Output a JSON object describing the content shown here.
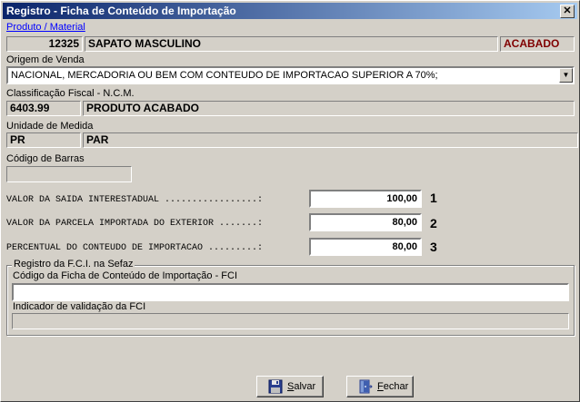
{
  "window": {
    "title": "Registro - Ficha de Conteúdo de Importação",
    "close_glyph": "✕"
  },
  "produto": {
    "label": "Produto / Material",
    "code": "12325",
    "name": "SAPATO MASCULINO",
    "status": "ACABADO",
    "status_color": "#800000"
  },
  "origem": {
    "label": "Origem de Venda",
    "selected": "NACIONAL, MERCADORIA OU BEM COM CONTEUDO DE IMPORTACAO SUPERIOR A 70%;",
    "arrow": "▼"
  },
  "ncm": {
    "label": "Classificação Fiscal - N.C.M.",
    "code": "6403.99",
    "description": "PRODUTO ACABADO"
  },
  "unidade": {
    "label": "Unidade de Medida",
    "code": "PR",
    "description": "PAR"
  },
  "barras": {
    "label": "Código de Barras",
    "value": ""
  },
  "valores": [
    {
      "label": "VALOR DA SAIDA INTERESTADUAL .................:",
      "value": "100,00",
      "marker": "1"
    },
    {
      "label": "VALOR DA PARCELA IMPORTADA DO EXTERIOR .......:",
      "value": "80,00",
      "marker": "2"
    },
    {
      "label": "PERCENTUAL DO CONTEUDO DE IMPORTACAO .........:",
      "value": "80,00",
      "marker": "3"
    }
  ],
  "fci": {
    "group_label": "Registro da F.C.I. na Sefaz",
    "codigo_label": "Código da Ficha de Conteúdo de Importação - FCI",
    "codigo_value": "",
    "indicador_label": "Indicador de validação da FCI",
    "indicador_value": ""
  },
  "buttons": {
    "salvar": "Salvar",
    "fechar": "Fechar",
    "salvar_icon": "floppy-disk-icon",
    "fechar_icon": "door-exit-icon"
  }
}
